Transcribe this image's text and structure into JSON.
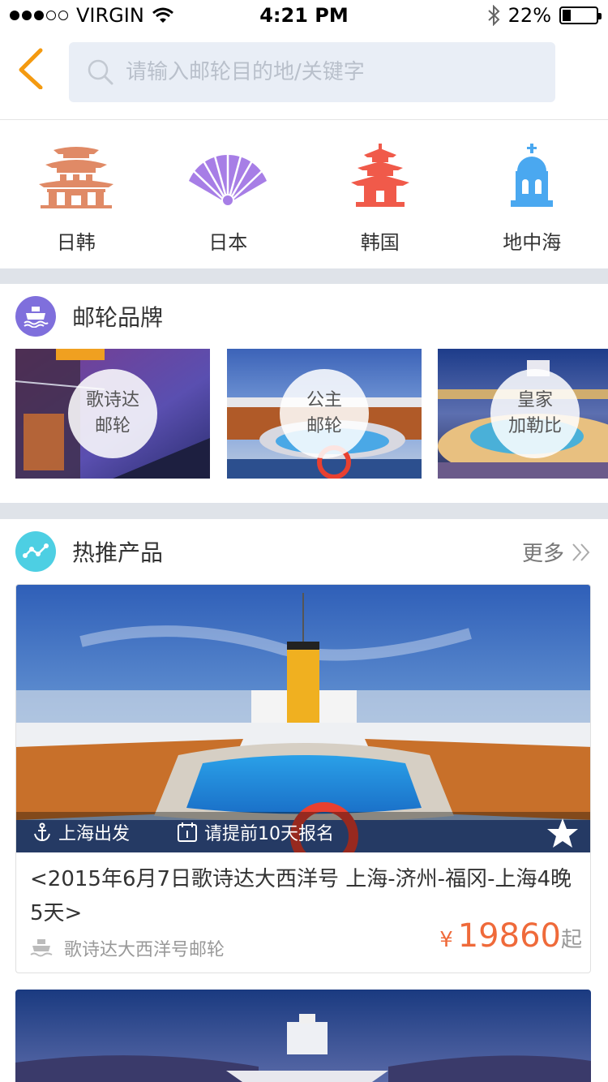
{
  "status_bar": {
    "carrier": "VIRGIN",
    "time": "4:21 PM",
    "battery": "22%",
    "battery_level": 0.22,
    "signal_bars": 3
  },
  "header": {
    "back_icon": "chevron-left-icon",
    "search_placeholder": "请输入邮轮目的地/关键字",
    "accent_color": "#f49a10"
  },
  "categories": [
    {
      "label": "日韩",
      "icon": "pagoda-gate-icon",
      "color": "#e08a66"
    },
    {
      "label": "日本",
      "icon": "folding-fan-icon",
      "color": "#a77ee6"
    },
    {
      "label": "韩国",
      "icon": "pagoda-icon",
      "color": "#f05a4a"
    },
    {
      "label": "地中海",
      "icon": "chapel-dome-icon",
      "color": "#4aa8f0"
    }
  ],
  "brands_section": {
    "title": "邮轮品牌",
    "icon": "ship-icon",
    "icon_color": "#7f6fdc",
    "items": [
      {
        "line1": "歌诗达",
        "line2": "邮轮"
      },
      {
        "line1": "公主",
        "line2": "邮轮"
      },
      {
        "line1": "皇家",
        "line2": "加勒比"
      }
    ]
  },
  "hot_section": {
    "title": "热推产品",
    "icon": "trend-icon",
    "icon_color": "#4dcfe3",
    "more_label": "更多"
  },
  "products": [
    {
      "departure": "上海出发",
      "signup_note": "请提前10天报名",
      "title": "<2015年6月7日歌诗达大西洋号 上海-济州-福冈-上海4晚5天>",
      "ship_name": "歌诗达大西洋号邮轮",
      "price_currency": "¥",
      "price": "19860",
      "price_suffix": "起",
      "price_color": "#ef6a3a"
    }
  ]
}
